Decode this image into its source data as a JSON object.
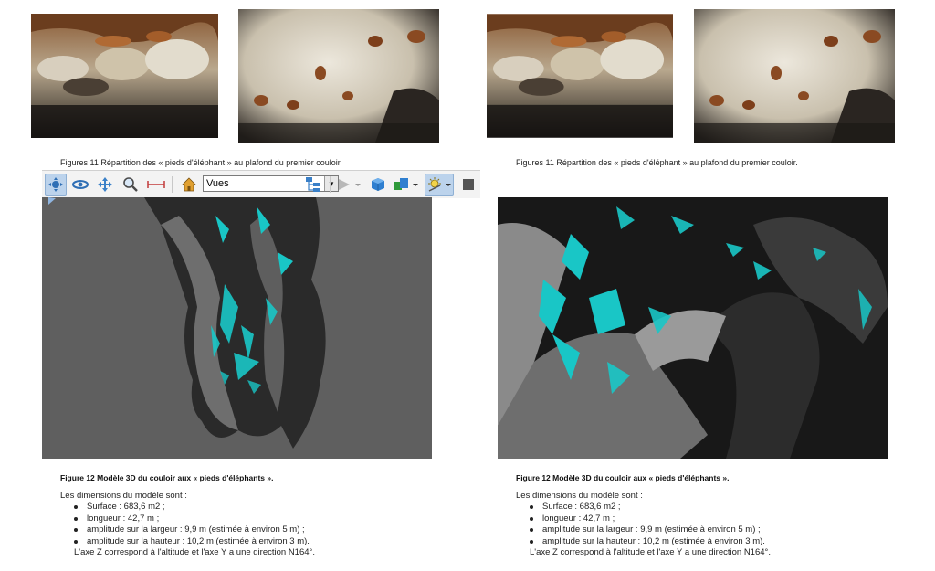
{
  "left_column": {
    "photos_caption": "Figures 11 Répartition des « pieds d'éléphant » au plafond du premier couloir.",
    "toolbar": {
      "views_select_value": "Vues",
      "icons": [
        "rotate-icon",
        "pan-orbit-icon",
        "move-icon",
        "zoom-icon",
        "measure-icon",
        "home-icon",
        "tree-icon",
        "play-icon",
        "cube-icon",
        "render-mode-icon",
        "light-icon",
        "stop-icon"
      ]
    },
    "model_caption": "Figure 12 Modèle 3D du couloir aux « pieds d'éléphants ».",
    "dimensions": {
      "intro": "Les dimensions du modèle sont :",
      "items": [
        "Surface : 683,6 m2 ;",
        "longueur : 42,7 m ;",
        "amplitude sur la largeur : 9,9 m (estimée à environ 5 m) ;",
        "amplitude sur la hauteur : 10,2 m (estimée à environ 3 m)."
      ],
      "footer": "L'axe Z correspond à l'altitude et l'axe Y a une direction N164°."
    }
  },
  "right_column": {
    "photos_caption": "Figures 11 Répartition des « pieds d'éléphant » au plafond du premier couloir.",
    "model_caption": "Figure 12 Modèle 3D du couloir aux « pieds d'éléphants ».",
    "dimensions": {
      "intro": "Les dimensions du modèle sont :",
      "items": [
        "Surface : 683,6 m2 ;",
        "longueur : 42,7 m ;",
        "amplitude sur la largeur : 9,9 m (estimée à environ 5 m) ;",
        "amplitude sur la hauteur : 10,2 m (estimée à environ 3 m)."
      ],
      "footer": "L'axe Z correspond à l'altitude et l'axe Y a une direction N164°."
    }
  },
  "colors": {
    "viewport_bg": "#5f5f5f",
    "highlight_cyan": "#19c6c6",
    "rock_cream": "#d8d2c4",
    "rock_brown": "#9a5a2c"
  }
}
